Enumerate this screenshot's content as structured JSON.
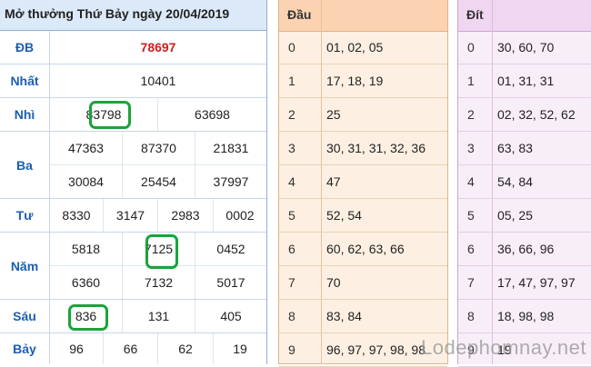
{
  "results": {
    "title": "Mở thưởng Thứ Bảy ngày 20/04/2019",
    "db_label": "ĐB",
    "db_value": "78697",
    "nhat_label": "Nhất",
    "nhat_value": "10401",
    "nhi_label": "Nhì",
    "nhi_values": [
      "83798",
      "63698"
    ],
    "ba_label": "Ba",
    "ba_row1": [
      "47363",
      "87370",
      "21831"
    ],
    "ba_row2": [
      "30084",
      "25454",
      "37997"
    ],
    "tu_label": "Tư",
    "tu_values": [
      "8330",
      "3147",
      "2983",
      "0002"
    ],
    "nam_label": "Năm",
    "nam_row1": [
      "5818",
      "7125",
      "0452"
    ],
    "nam_row2": [
      "6360",
      "7132",
      "5017"
    ],
    "sau_label": "Sáu",
    "sau_values": [
      "836",
      "131",
      "405"
    ],
    "bay_label": "Bảy",
    "bay_values": [
      "96",
      "66",
      "62",
      "19"
    ]
  },
  "dau": {
    "header": "Đầu",
    "rows": [
      {
        "i": "0",
        "v": "01, 02, 05"
      },
      {
        "i": "1",
        "v": "17, 18, 19"
      },
      {
        "i": "2",
        "v": "25"
      },
      {
        "i": "3",
        "v": "30, 31, 31, 32, 36"
      },
      {
        "i": "4",
        "v": "47"
      },
      {
        "i": "5",
        "v": "52, 54"
      },
      {
        "i": "6",
        "v": "60, 62, 63, 66"
      },
      {
        "i": "7",
        "v": "70"
      },
      {
        "i": "8",
        "v": "83, 84"
      },
      {
        "i": "9",
        "v": "96, 97, 97, 98, 98"
      }
    ]
  },
  "dit": {
    "header": "Đít",
    "rows": [
      {
        "i": "0",
        "v": "30, 60, 70"
      },
      {
        "i": "1",
        "v": "01, 31, 31"
      },
      {
        "i": "2",
        "v": "02, 32, 52, 62"
      },
      {
        "i": "3",
        "v": "63, 83"
      },
      {
        "i": "4",
        "v": "54, 84"
      },
      {
        "i": "5",
        "v": "05, 25"
      },
      {
        "i": "6",
        "v": "36, 66, 96"
      },
      {
        "i": "7",
        "v": "17, 47, 97, 97"
      },
      {
        "i": "8",
        "v": "18, 98, 98"
      },
      {
        "i": "9",
        "v": "19"
      }
    ]
  },
  "watermark": "Lodephomnay.net",
  "colors": {
    "accent_label": "#1a5fb0",
    "special_prize": "#cc1f1f",
    "highlight_ring": "#1aa33a"
  }
}
